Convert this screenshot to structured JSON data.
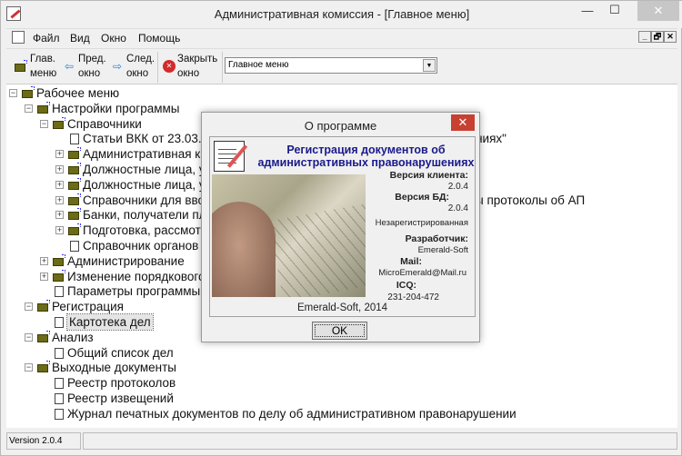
{
  "window": {
    "title": "Административная комиссия - [Главное меню]",
    "min": "—",
    "max": "☐",
    "close": "✕"
  },
  "menu": [
    "Файл",
    "Вид",
    "Окно",
    "Помощь"
  ],
  "mdi": {
    "min": "_",
    "restore": "🗗",
    "close": "✕"
  },
  "toolbar": {
    "main_l1": "Глав.",
    "main_l2": "меню",
    "prev_l1": "Пред.",
    "prev_l2": "окно",
    "next_l1": "След.",
    "next_l2": "окно",
    "close_l1": "Закрыть",
    "close_l2": "окно",
    "combo_value": "Главное меню"
  },
  "tree": [
    {
      "level": 0,
      "type": "folder",
      "exp": "−",
      "label": "Рабочее меню"
    },
    {
      "level": 1,
      "type": "folder",
      "exp": "−",
      "label": "Настройки программы"
    },
    {
      "level": 2,
      "type": "folder",
      "exp": "−",
      "label": "Справочники"
    },
    {
      "level": 3,
      "type": "doc",
      "label": "Статьи ВКК от 23.03.",
      "tail": "ушениях\""
    },
    {
      "level": 3,
      "type": "folder",
      "exp": "+",
      "label": "Административная ко"
    },
    {
      "level": 3,
      "type": "folder",
      "exp": "+",
      "label": "Должностные лица, у"
    },
    {
      "level": 3,
      "type": "folder",
      "exp": "+",
      "label": "Должностные лица, у"
    },
    {
      "level": 3,
      "type": "folder",
      "exp": "+",
      "label": "Справочники для вво",
      "tail": "ы протоколы об АП"
    },
    {
      "level": 3,
      "type": "folder",
      "exp": "+",
      "label": "Банки, получатели пла"
    },
    {
      "level": 3,
      "type": "folder",
      "exp": "+",
      "label": "Подготовка, рассмот"
    },
    {
      "level": 3,
      "type": "doc",
      "label": "Справочник органов"
    },
    {
      "level": 2,
      "type": "folder",
      "exp": "+",
      "label": "Администрирование"
    },
    {
      "level": 2,
      "type": "folder",
      "exp": "+",
      "label": "Изменение порядкового"
    },
    {
      "level": 2,
      "type": "doc",
      "label": "Параметры программы"
    },
    {
      "level": 1,
      "type": "folder",
      "exp": "−",
      "label": "Регистрация"
    },
    {
      "level": 2,
      "type": "doc",
      "label": "Картотека дел",
      "selected": true
    },
    {
      "level": 1,
      "type": "folder",
      "exp": "−",
      "label": "Анализ"
    },
    {
      "level": 2,
      "type": "doc",
      "label": "Общий список дел"
    },
    {
      "level": 1,
      "type": "folder",
      "exp": "−",
      "label": "Выходные документы"
    },
    {
      "level": 2,
      "type": "doc",
      "label": "Реестр протоколов"
    },
    {
      "level": 2,
      "type": "doc",
      "label": "Реестр извещений"
    },
    {
      "level": 2,
      "type": "doc",
      "label": "Журнал печатных документов по делу об административном правонарушении"
    }
  ],
  "status": {
    "version": "Version 2.0.4"
  },
  "dialog": {
    "title": "О программе",
    "close": "✕",
    "heading1": "Регистрация документов об",
    "heading2": "административных правонарушениях",
    "client_ver_label": "Версия клиента:",
    "client_ver": "2.0.4",
    "db_ver_label": "Версия БД:",
    "db_ver": "2.0.4",
    "reg_status": "Незарегистрированная",
    "dev_label": "Разработчик:",
    "dev": "Emerald-Soft",
    "mail_label": "Mail:",
    "mail": "MicroEmerald@Mail.ru",
    "icq_label": "ICQ:",
    "icq": "231-204-472",
    "footer": "Emerald-Soft, 2014",
    "ok": "OK"
  }
}
